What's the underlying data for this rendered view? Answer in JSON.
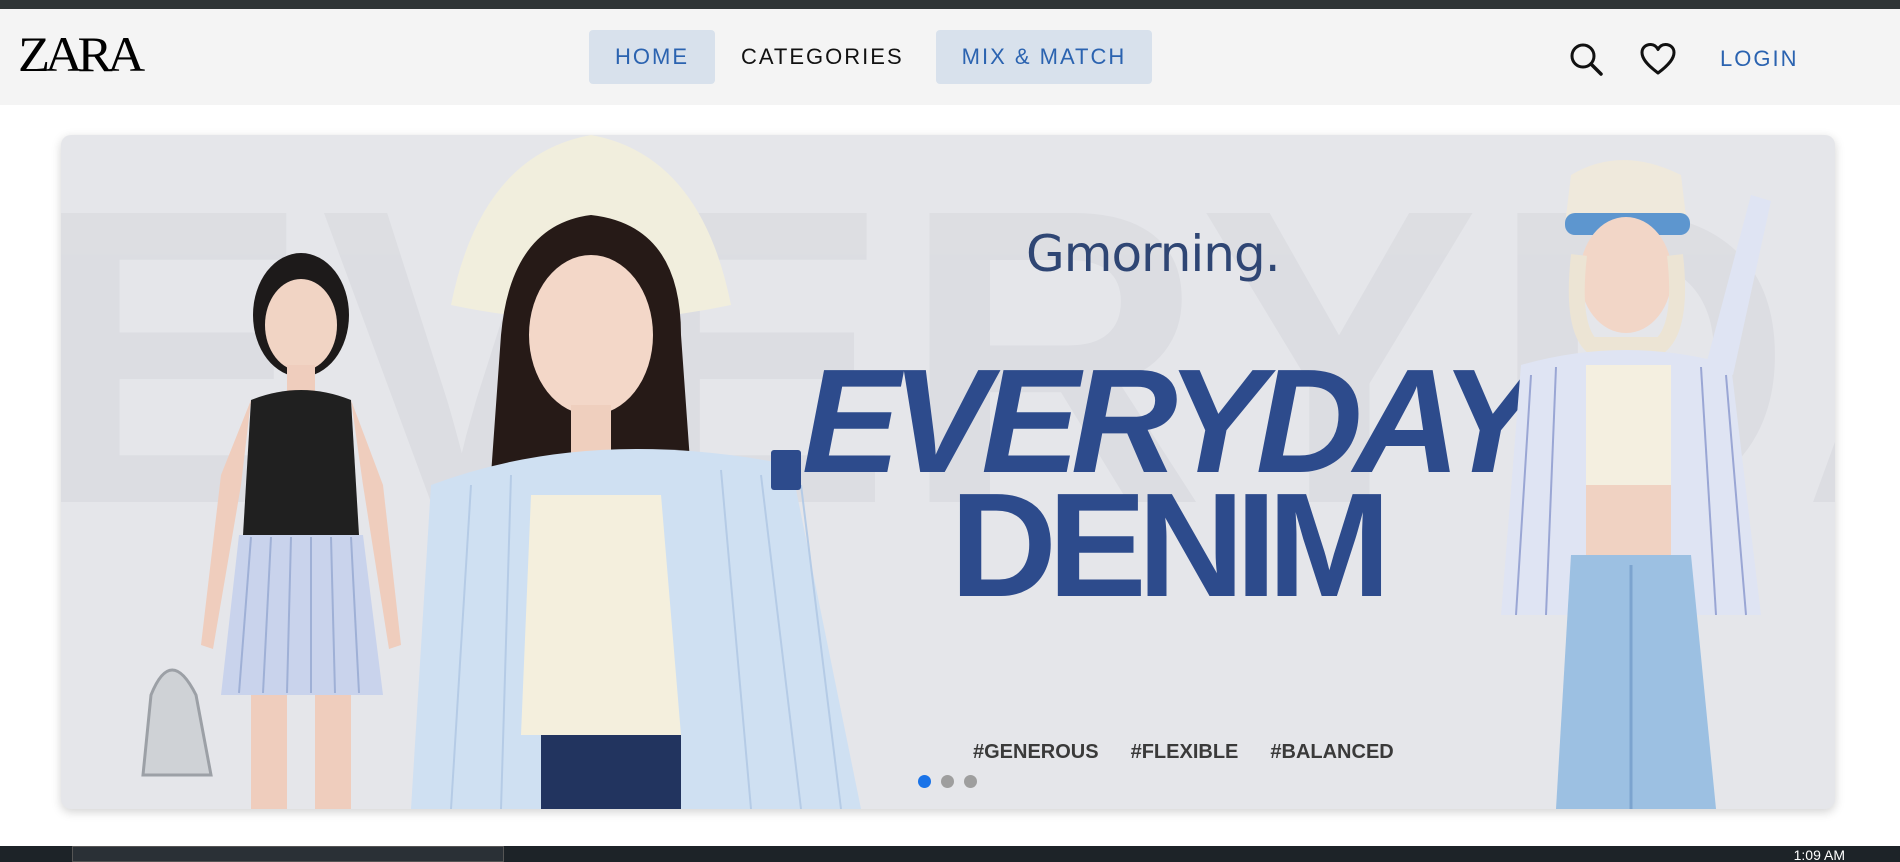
{
  "header": {
    "logo": "ZARA",
    "nav": [
      {
        "label": "HOME",
        "active": true
      },
      {
        "label": "CATEGORIES",
        "active": false
      },
      {
        "label": "MIX & MATCH",
        "active": true
      }
    ],
    "icons": [
      "search-icon",
      "heart-icon"
    ],
    "login_label": "LOGIN"
  },
  "banner": {
    "background_text": "EVERYDAY",
    "brand": "Gmorning.",
    "headline_line1": "EVERYDAY",
    "headline_line2": "DENIM",
    "tags": [
      "#GENEROUS",
      "#FLEXIBLE",
      "#BALANCED"
    ],
    "slides_total": 3,
    "active_slide": 1
  },
  "taskbar": {
    "clock": "1:09 AM"
  },
  "colors": {
    "accent": "#2b63b0",
    "headline": "#2d4b8c",
    "nav_active_bg": "#d8e1ec"
  }
}
